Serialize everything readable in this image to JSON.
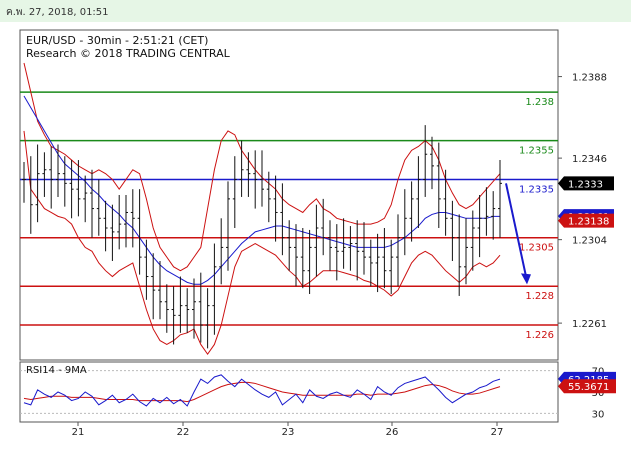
{
  "timestamp": "ค.พ. 27, 2018, 01:51",
  "chart_data": [
    {
      "type": "candlestick",
      "title": "EUR/USD - 30min - 2:51:21 (CET)",
      "subtitle": "Research © 2018 TRADING CENTRAL",
      "ylim": [
        1.2242,
        1.2412
      ],
      "yticks": [
        "1.2388",
        "1.2346",
        "1.2304",
        "1.2261"
      ],
      "xticks": [
        "21",
        "22",
        "23",
        "26",
        "27"
      ],
      "levels": [
        {
          "label": "1.238",
          "value": 1.238,
          "color": "#1a8a1a"
        },
        {
          "label": "1.2355",
          "value": 1.2355,
          "color": "#1a8a1a"
        },
        {
          "label": "1.2335",
          "value": 1.2335,
          "color": "#1a1acc"
        },
        {
          "label": "1.2305",
          "value": 1.2305,
          "color": "#cc1111"
        },
        {
          "label": "1.228",
          "value": 1.228,
          "color": "#cc1111"
        },
        {
          "label": "1.226",
          "value": 1.226,
          "color": "#cc1111"
        }
      ],
      "badges": [
        {
          "label": "1.2333",
          "value": 1.2333,
          "bg": "#000000"
        },
        {
          "label": "1.23161",
          "value": 1.23161,
          "bg": "#1a1acc"
        },
        {
          "label": "1.23138",
          "value": 1.23138,
          "bg": "#cc1111"
        }
      ],
      "price": [
        1.2335,
        1.2322,
        1.2338,
        1.234,
        1.2335,
        1.2338,
        1.2333,
        1.233,
        1.2325,
        1.2328,
        1.232,
        1.2315,
        1.231,
        1.2308,
        1.2312,
        1.2318,
        1.2315,
        1.2295,
        1.2285,
        1.2278,
        1.2272,
        1.2268,
        1.2265,
        1.227,
        1.2268,
        1.2272,
        1.226,
        1.227,
        1.229,
        1.23,
        1.2325,
        1.2335,
        1.234,
        1.2338,
        1.2335,
        1.233,
        1.2325,
        1.2318,
        1.2305,
        1.23,
        1.2295,
        1.2288,
        1.23,
        1.231,
        1.2305,
        1.23,
        1.2298,
        1.23,
        1.2302,
        1.2298,
        1.2295,
        1.2292,
        1.2295,
        1.2288,
        1.2295,
        1.2305,
        1.2315,
        1.2325,
        1.2335,
        1.2348,
        1.2342,
        1.2325,
        1.2315,
        1.2305,
        1.229,
        1.23,
        1.231,
        1.2315,
        1.2316,
        1.232,
        1.2333
      ],
      "ma_blue": [
        1.2378,
        1.2372,
        1.2366,
        1.236,
        1.2354,
        1.2348,
        1.2343,
        1.234,
        1.2337,
        1.2334,
        1.233,
        1.2327,
        1.2323,
        1.232,
        1.2317,
        1.2313,
        1.231,
        1.2305,
        1.23,
        1.2295,
        1.2291,
        1.2288,
        1.2286,
        1.2284,
        1.2282,
        1.2281,
        1.2281,
        1.2283,
        1.2286,
        1.229,
        1.2294,
        1.2298,
        1.2302,
        1.2305,
        1.2308,
        1.2309,
        1.231,
        1.2311,
        1.2311,
        1.231,
        1.2309,
        1.2308,
        1.2307,
        1.2306,
        1.2305,
        1.2304,
        1.2303,
        1.2302,
        1.2301,
        1.23,
        1.23,
        1.23,
        1.23,
        1.23,
        1.2301,
        1.2303,
        1.2305,
        1.2308,
        1.2311,
        1.2315,
        1.2317,
        1.2318,
        1.2318,
        1.2317,
        1.2316,
        1.2315,
        1.2315,
        1.2315,
        1.2315,
        1.2316,
        1.2316
      ],
      "bb_upper": [
        1.2395,
        1.238,
        1.2365,
        1.2358,
        1.2352,
        1.235,
        1.2348,
        1.2345,
        1.2342,
        1.234,
        1.2338,
        1.234,
        1.2338,
        1.2335,
        1.233,
        1.2335,
        1.234,
        1.2338,
        1.2325,
        1.231,
        1.23,
        1.2295,
        1.229,
        1.2288,
        1.229,
        1.2295,
        1.23,
        1.232,
        1.234,
        1.2355,
        1.236,
        1.2358,
        1.235,
        1.2345,
        1.234,
        1.2336,
        1.2333,
        1.233,
        1.2325,
        1.2322,
        1.232,
        1.2318,
        1.2322,
        1.2325,
        1.232,
        1.2318,
        1.2315,
        1.2314,
        1.2313,
        1.2312,
        1.2312,
        1.2312,
        1.2313,
        1.2315,
        1.2322,
        1.2335,
        1.2345,
        1.235,
        1.2352,
        1.2355,
        1.2352,
        1.2345,
        1.2335,
        1.2328,
        1.2322,
        1.232,
        1.2322,
        1.2326,
        1.233,
        1.2334,
        1.2338
      ],
      "bb_lower": [
        1.236,
        1.233,
        1.2325,
        1.232,
        1.2318,
        1.2316,
        1.2315,
        1.2312,
        1.2305,
        1.23,
        1.2298,
        1.2292,
        1.2288,
        1.2285,
        1.2288,
        1.229,
        1.2292,
        1.228,
        1.2268,
        1.2258,
        1.2252,
        1.225,
        1.2252,
        1.2255,
        1.2256,
        1.2258,
        1.225,
        1.2245,
        1.225,
        1.226,
        1.2275,
        1.229,
        1.2298,
        1.23,
        1.2302,
        1.23,
        1.2298,
        1.2296,
        1.2292,
        1.2288,
        1.2285,
        1.228,
        1.2282,
        1.2285,
        1.2288,
        1.2288,
        1.2288,
        1.2287,
        1.2286,
        1.2285,
        1.2283,
        1.2282,
        1.228,
        1.2278,
        1.2275,
        1.2278,
        1.2285,
        1.2292,
        1.2296,
        1.2298,
        1.2296,
        1.2292,
        1.2288,
        1.2285,
        1.2282,
        1.2285,
        1.229,
        1.2292,
        1.229,
        1.2292,
        1.2296
      ],
      "forecast_arrow": [
        1.2333,
        1.2282
      ]
    },
    {
      "type": "line",
      "title": "RSI14 - 9MA",
      "ylim": [
        22,
        78
      ],
      "yticks": [
        "70",
        "50",
        "30"
      ],
      "badges": [
        {
          "label": "62.2185",
          "value": 62.2185,
          "bg": "#1a1acc"
        },
        {
          "label": "55.3671",
          "value": 55.3671,
          "bg": "#cc1111"
        }
      ],
      "rsi": [
        40,
        38,
        52,
        48,
        45,
        50,
        47,
        42,
        44,
        50,
        46,
        38,
        42,
        47,
        40,
        43,
        48,
        41,
        37,
        44,
        40,
        45,
        39,
        43,
        37,
        50,
        62,
        58,
        64,
        66,
        60,
        55,
        62,
        57,
        52,
        48,
        45,
        50,
        38,
        43,
        48,
        40,
        52,
        46,
        44,
        48,
        50,
        47,
        45,
        52,
        48,
        43,
        55,
        50,
        47,
        54,
        58,
        60,
        62,
        64,
        58,
        52,
        45,
        40,
        44,
        48,
        50,
        54,
        56,
        60,
        62
      ],
      "rsi_ma": [
        44,
        43,
        44,
        45,
        46,
        46,
        46,
        45,
        45,
        45,
        45,
        44,
        43,
        43,
        43,
        43,
        43,
        42,
        42,
        42,
        42,
        42,
        42,
        42,
        41,
        43,
        46,
        49,
        52,
        55,
        57,
        58,
        59,
        59,
        58,
        56,
        54,
        52,
        50,
        49,
        48,
        47,
        47,
        47,
        47,
        47,
        47,
        47,
        47,
        48,
        48,
        47,
        48,
        48,
        48,
        49,
        50,
        52,
        54,
        56,
        57,
        56,
        54,
        51,
        49,
        48,
        48,
        49,
        51,
        53,
        55
      ]
    }
  ]
}
